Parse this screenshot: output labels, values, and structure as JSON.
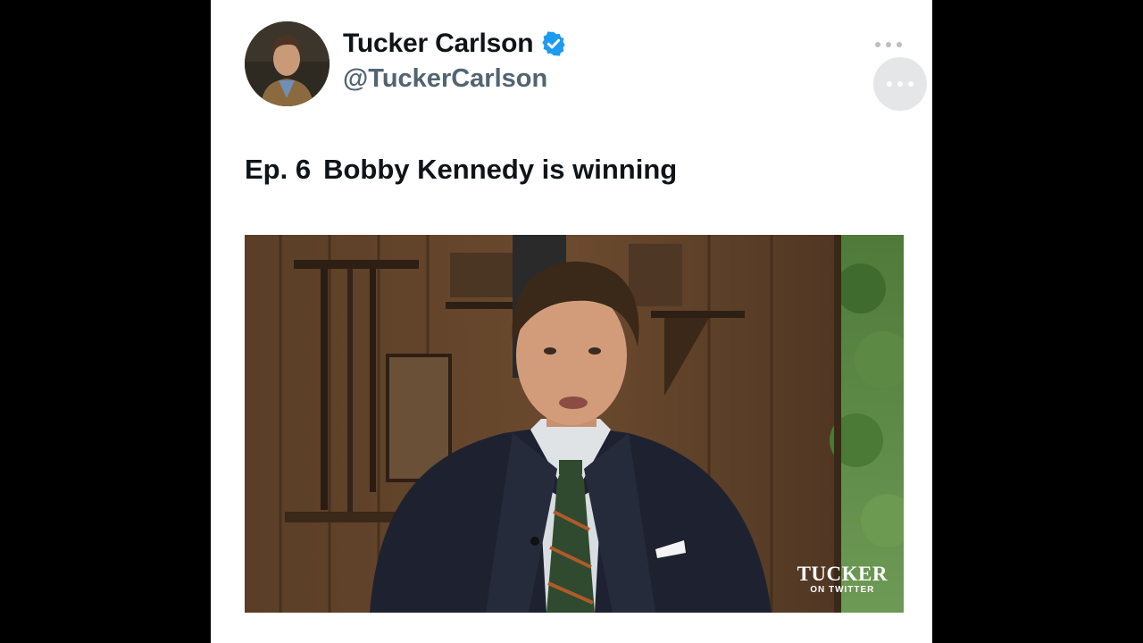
{
  "post": {
    "author": {
      "display_name": "Tucker Carlson",
      "handle": "@TuckerCarlson",
      "verified": true,
      "verified_color": "#1d9bf0",
      "avatar_icon": "profile-photo"
    },
    "menu_icon": "more-horizontal-icon",
    "text": {
      "episode": "Ep. 6",
      "title": "Bobby Kennedy is winning"
    },
    "video": {
      "watermark_main": "TUCKER",
      "watermark_sub": "ON TWITTER"
    }
  },
  "colors": {
    "page_background": "#000000",
    "card_background": "#ffffff",
    "name_color": "#0f1419",
    "handle_color": "#536471"
  }
}
